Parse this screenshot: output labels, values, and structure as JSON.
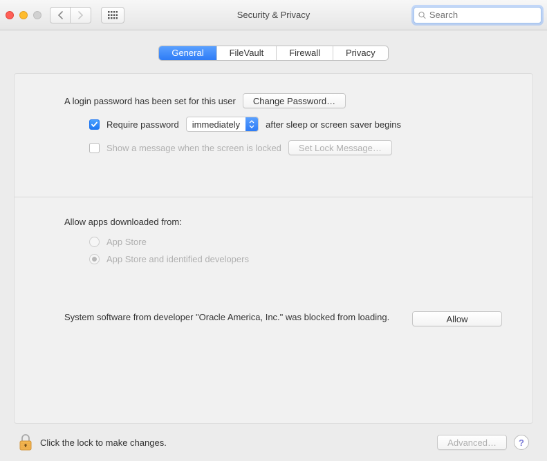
{
  "toolbar": {
    "title": "Security & Privacy",
    "search_placeholder": "Search"
  },
  "tabs": {
    "general": "General",
    "filevault": "FileVault",
    "firewall": "Firewall",
    "privacy": "Privacy"
  },
  "login": {
    "password_set_text": "A login password has been set for this user",
    "change_password_btn": "Change Password…",
    "require_password_label": "Require password",
    "require_password_delay": "immediately",
    "require_password_suffix": "after sleep or screen saver begins",
    "show_message_label": "Show a message when the screen is locked",
    "set_lock_message_btn": "Set Lock Message…"
  },
  "apps": {
    "header": "Allow apps downloaded from:",
    "opt_appstore": "App Store",
    "opt_identified": "App Store and identified developers",
    "blocked_text": "System software from developer \"Oracle America, Inc.\" was blocked from loading.",
    "allow_btn": "Allow"
  },
  "footer": {
    "lock_text": "Click the lock to make changes.",
    "advanced_btn": "Advanced…"
  }
}
